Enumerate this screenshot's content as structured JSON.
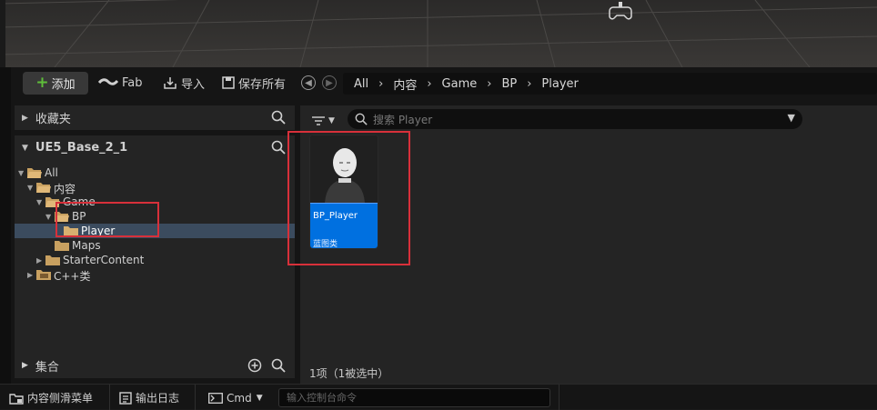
{
  "toolbar": {
    "add_label": "添加",
    "fab_label": "Fab",
    "import_label": "导入",
    "save_all_label": "保存所有"
  },
  "breadcrumb": [
    "All",
    "内容",
    "Game",
    "BP",
    "Player"
  ],
  "left_panel": {
    "favorites_label": "收藏夹",
    "project_label": "UE5_Base_2_1",
    "collections_label": "集合",
    "tree": [
      {
        "label": "All",
        "level": 0,
        "expanded": true
      },
      {
        "label": "内容",
        "level": 1,
        "expanded": true
      },
      {
        "label": "Game",
        "level": 2,
        "expanded": true
      },
      {
        "label": "BP",
        "level": 3,
        "expanded": true
      },
      {
        "label": "Player",
        "level": 4,
        "selected": true
      },
      {
        "label": "Maps",
        "level": 3
      },
      {
        "label": "StarterContent",
        "level": 2,
        "collapsed": true
      },
      {
        "label": "C++类",
        "level": 1,
        "collapsed": true
      }
    ]
  },
  "content": {
    "search_placeholder": "搜索 Player",
    "asset": {
      "name": "BP_Player",
      "type": "蓝图类"
    },
    "status": "1项（1被选中）"
  },
  "statusbar": {
    "content_drawer_label": "内容侧滑菜单",
    "output_log_label": "输出日志",
    "cmd_label": "Cmd",
    "console_placeholder": "输入控制台命令"
  },
  "colors": {
    "accent_blue": "#0070e0",
    "selection": "#3b4b5e",
    "annotation_red": "#d8303a",
    "add_plus_green": "#5fbf3a"
  }
}
